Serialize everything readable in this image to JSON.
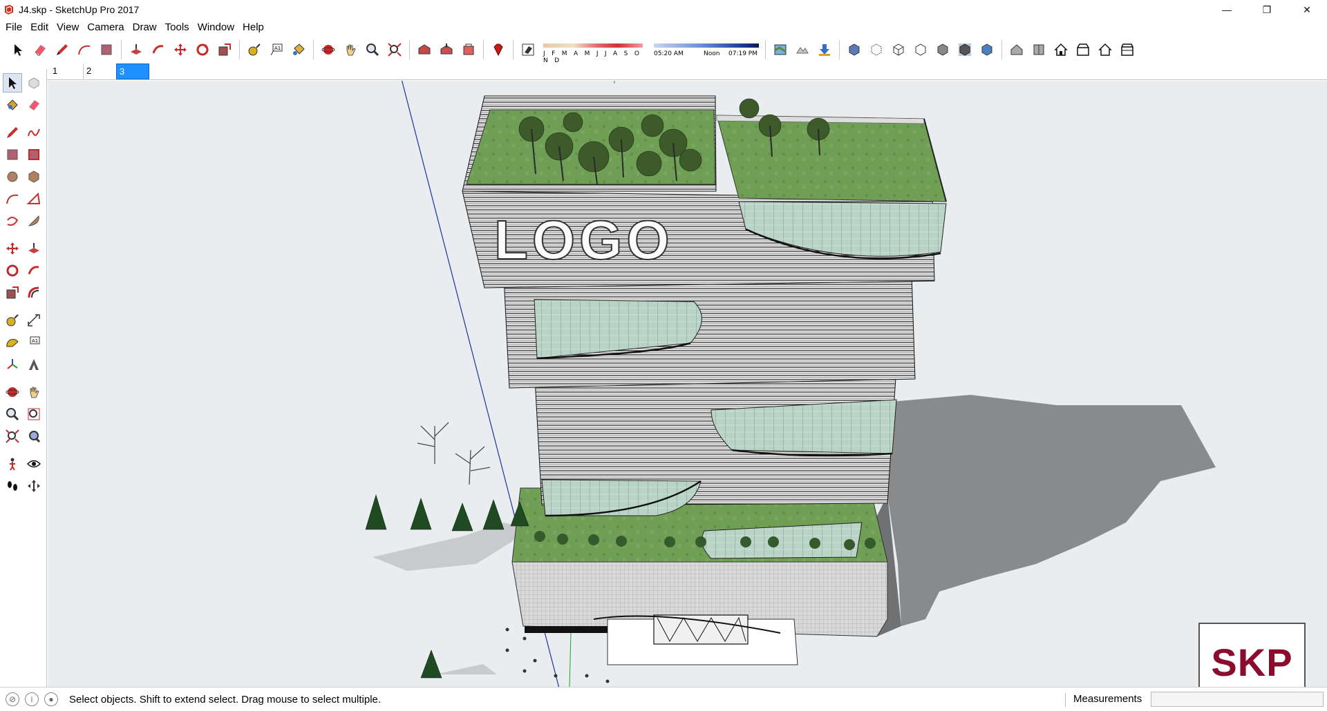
{
  "window": {
    "title": "J4.skp - SketchUp Pro 2017",
    "controls": {
      "minimize": "—",
      "restore": "❐",
      "close": "✕"
    }
  },
  "menu": [
    "File",
    "Edit",
    "View",
    "Camera",
    "Draw",
    "Tools",
    "Window",
    "Help"
  ],
  "toolbar": {
    "shadow_months_label": "J F M A M J J A S O N D",
    "shadow_time_start": "05:20 AM",
    "shadow_time_mid": "Noon",
    "shadow_time_end": "07:19 PM"
  },
  "scenes": {
    "tabs": [
      "1",
      "2",
      "3"
    ],
    "active_index": 2
  },
  "viewport": {
    "facade_text": "LOGO",
    "badge_text": "SKP",
    "colors": {
      "background": "#e9edf0",
      "grass": "#6a9a50",
      "shadow": "#888a8c",
      "badge": "#8b0d2e"
    }
  },
  "statusbar": {
    "message": "Select objects. Shift to extend select. Drag mouse to select multiple.",
    "measurements_label": "Measurements",
    "measurements_value": ""
  }
}
